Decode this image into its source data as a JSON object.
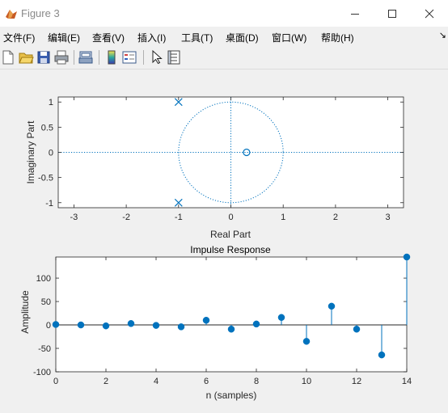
{
  "window": {
    "title": "Figure 3"
  },
  "menu": [
    "文件(F)",
    "编辑(E)",
    "查看(V)",
    "插入(I)",
    "工具(T)",
    "桌面(D)",
    "窗口(W)",
    "帮助(H)"
  ],
  "toolbar": {
    "icons": [
      "new-file-icon",
      "open-folder-icon",
      "save-icon",
      "print-icon",
      "print-preview-icon",
      "colorbar-icon",
      "legend-icon",
      "pointer-icon",
      "property-inspector-icon"
    ]
  },
  "chart_data": [
    {
      "type": "scatter",
      "title": "",
      "xlabel": "Real Part",
      "ylabel": "Imaginary Part",
      "xlim": [
        -3.3,
        3.3
      ],
      "ylim": [
        -1.1,
        1.1
      ],
      "xticks": [
        "-3",
        "-2",
        "-1",
        "0",
        "1",
        "2",
        "3"
      ],
      "yticks": [
        "1",
        "0.5",
        "0",
        "-0.5",
        "-1"
      ],
      "unit_circle": true,
      "series": [
        {
          "marker": "x",
          "points": [
            [
              -1,
              1
            ],
            [
              -1,
              -1
            ]
          ]
        },
        {
          "marker": "o",
          "points": [
            [
              0.3,
              0
            ]
          ]
        }
      ],
      "color": "#0072bd"
    },
    {
      "type": "stem",
      "title": "Impulse Response",
      "xlabel": "n (samples)",
      "ylabel": "Amplitude",
      "xlim": [
        0,
        14
      ],
      "ylim": [
        -100,
        145
      ],
      "xticks": [
        "0",
        "2",
        "4",
        "6",
        "8",
        "10",
        "12",
        "14"
      ],
      "yticks": [
        "100",
        "50",
        "0",
        "-50",
        "-100"
      ],
      "x": [
        0,
        1,
        2,
        3,
        4,
        5,
        6,
        7,
        8,
        9,
        10,
        11,
        12,
        13,
        14
      ],
      "values": [
        1,
        0,
        -2,
        3,
        -1,
        -4,
        10,
        -9,
        2,
        16,
        -35,
        40,
        -9,
        -64,
        145
      ],
      "color": "#0072bd"
    }
  ]
}
